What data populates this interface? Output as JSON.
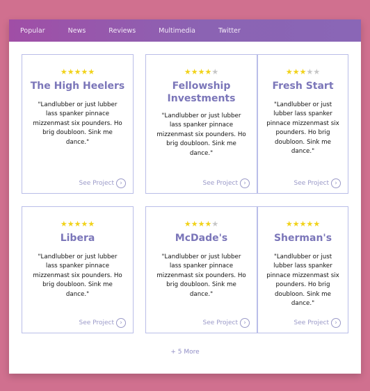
{
  "nav": {
    "items": [
      {
        "label": "Popular"
      },
      {
        "label": "News"
      },
      {
        "label": "Reviews"
      },
      {
        "label": "Multimedia"
      },
      {
        "label": "Twitter"
      }
    ]
  },
  "cards": [
    {
      "title": "The High Heelers",
      "rating": 5,
      "max_rating": 5,
      "quote": "\"Landlubber or just lubber lass spanker pinnace mizzenmast six pounders. Ho brig doubloon. Sink me dance.\"",
      "cta": "See Project"
    },
    {
      "title": "Fellowship Investments",
      "rating": 4,
      "max_rating": 5,
      "quote": "\"Landlubber or just lubber lass spanker pinnace mizzenmast six pounders. Ho brig doubloon. Sink me dance.\"",
      "cta": "See Project"
    },
    {
      "title": "Fresh Start",
      "rating": 3,
      "max_rating": 5,
      "quote": "\"Landlubber or just lubber lass spanker pinnace mizzenmast six pounders. Ho brig doubloon. Sink me dance.\"",
      "cta": "See Project"
    },
    {
      "title": "Libera",
      "rating": 5,
      "max_rating": 5,
      "quote": "\"Landlubber or just lubber lass spanker pinnace mizzenmast six pounders. Ho brig doubloon. Sink me dance.\"",
      "cta": "See Project"
    },
    {
      "title": "McDade's",
      "rating": 4,
      "max_rating": 5,
      "quote": "\"Landlubber or just lubber lass spanker pinnace mizzenmast six pounders. Ho brig doubloon. Sink me dance.\"",
      "cta": "See Project"
    },
    {
      "title": "Sherman's",
      "rating": 5,
      "max_rating": 5,
      "quote": "\"Landlubber or just lubber lass spanker pinnace mizzenmast six pounders. Ho brig doubloon. Sink me dance.\"",
      "cta": "See Project"
    }
  ],
  "more": {
    "label": "+ 5 More"
  },
  "colors": {
    "background": "#d0708f",
    "nav_start": "#a04ea6",
    "nav_end": "#8a66b6",
    "title": "#7b76b9",
    "star_on": "#f1d21a",
    "star_off": "#c6c6c6",
    "card_border": "#b9bde8"
  },
  "icons": {
    "cta": "chevron-right-circle-icon",
    "star": "star-icon"
  }
}
